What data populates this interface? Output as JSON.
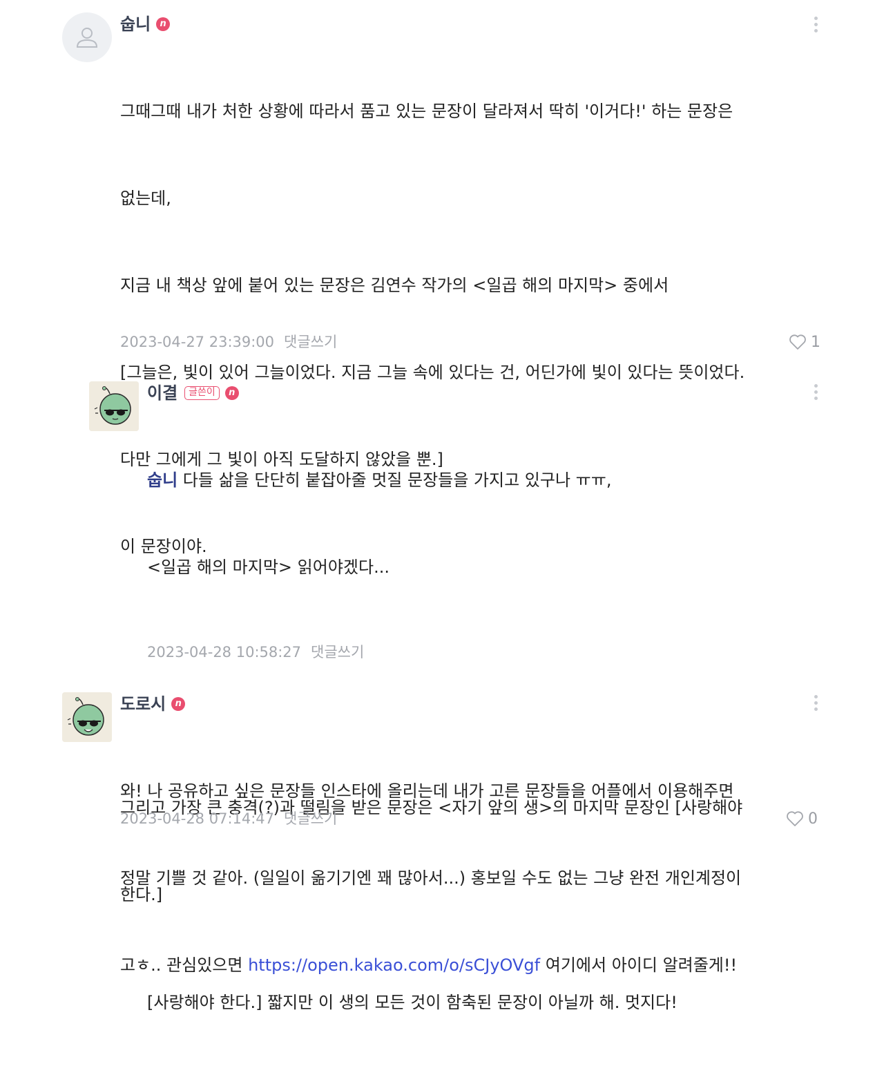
{
  "comments": [
    {
      "author": "숩니",
      "body": [
        "그때그때 내가 처한 상황에 따라서 품고 있는 문장이 달라져서 딱히 '이거다!' 하는 문장은",
        "없는데,",
        "지금 내 책상 앞에 붙어 있는 문장은 김연수 작가의 <일곱 해의 마지막> 중에서",
        "[그늘은, 빛이 있어 그늘이었다. 지금 그늘 속에 있다는 건, 어딘가에 빛이 있다는 뜻이었다.",
        "다만 그에게 그 빛이 아직 도달하지 않았을 뿐.]",
        "이 문장이야.",
        "",
        "",
        "그리고 가장 큰 충격(?)과 떨림을 받은 문장은 <자기 앞의 생>의 마지막 문장인 [사랑해야",
        "한다.]"
      ],
      "date": "2023-04-27 23:39:00",
      "reply_label": "댓글쓰기",
      "likes": "1"
    },
    {
      "author": "이결",
      "writer_badge": "글쓴이",
      "mention": "숩니",
      "body_first": " 다들 삶을 단단히 붙잡아줄 멋질 문장들을 가지고 있구나 ㅠㅠ,",
      "body": [
        "<일곱 해의 마지막> 읽어야겠다...",
        "",
        "",
        "",
        "",
        "[사랑해야 한다.] 짧지만 이 생의 모든 것이 함축된 문장이 아닐까 해. 멋지다!"
      ],
      "date": "2023-04-28 10:58:27",
      "reply_label": "댓글쓰기"
    },
    {
      "author": "도로시",
      "body": [
        "와! 나 공유하고 싶은 문장들 인스타에 올리는데 내가 고른 문장들을 어플에서 이용해주면",
        "정말 기쁠 것 같아. (일일이 옮기기엔 꽤 많아서...) 홍보일 수도 없는 그냥 완전 개인계정이"
      ],
      "body_last_prefix": "고ㅎ.. 관심있으면 ",
      "link": "https://open.kakao.com/o/sCJyOVgf",
      "body_last_suffix": " 여기에서 아이디 알려줄게!!",
      "date": "2023-04-28 07:14:47",
      "reply_label": "댓글쓰기",
      "likes": "0"
    }
  ],
  "badge_letter": "n",
  "icons": {
    "more": "more-vertical-icon",
    "like": "heart-outline-icon",
    "default_avatar": "user-icon"
  },
  "colors": {
    "author": "#3a4254",
    "badge": "#e94e6f",
    "mention": "#2f3d8a",
    "link": "#3a4fd6",
    "meta": "#a4a7ad"
  }
}
